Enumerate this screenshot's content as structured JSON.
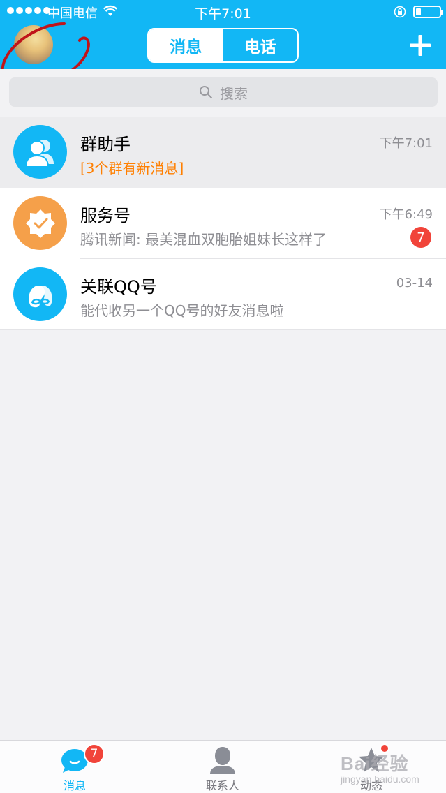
{
  "status_bar": {
    "carrier": "中国电信",
    "time": "下午7:01"
  },
  "nav": {
    "tabs": [
      {
        "label": "消息",
        "active": true
      },
      {
        "label": "电话",
        "active": false
      }
    ],
    "add_icon": "plus-icon",
    "accent_color": "#12b7f5"
  },
  "search": {
    "placeholder": "搜索"
  },
  "conversations": [
    {
      "title": "群助手",
      "time": "下午7:01",
      "subtitle": "[3个群有新消息]",
      "icon": "group-helper-icon",
      "icon_color": "#12b7f5",
      "selected": true
    },
    {
      "title": "服务号",
      "time": "下午6:49",
      "subtitle": "腾讯新闻: 最美混血双胞胎姐妹长这样了",
      "badge": "7",
      "icon": "service-badge-icon",
      "icon_color": "#f5a04a"
    },
    {
      "title": "关联QQ号",
      "time": "03-14",
      "subtitle": "能代收另一个QQ号的好友消息啦",
      "icon": "linked-qq-icon",
      "icon_color": "#12b7f5"
    }
  ],
  "tabbar": {
    "items": [
      {
        "label": "消息",
        "badge": "7",
        "icon": "chat-bubble-icon",
        "active": true
      },
      {
        "label": "联系人",
        "icon": "contact-person-icon",
        "active": false
      },
      {
        "label": "动态",
        "icon": "star-icon",
        "active": false,
        "dot": true
      }
    ]
  },
  "watermark": {
    "main": "Bai经验",
    "sub": "jingyan.baidu.com"
  },
  "colors": {
    "badge": "#f1443a",
    "annotation": "#c0141a",
    "orange_text": "#ff7f00"
  }
}
